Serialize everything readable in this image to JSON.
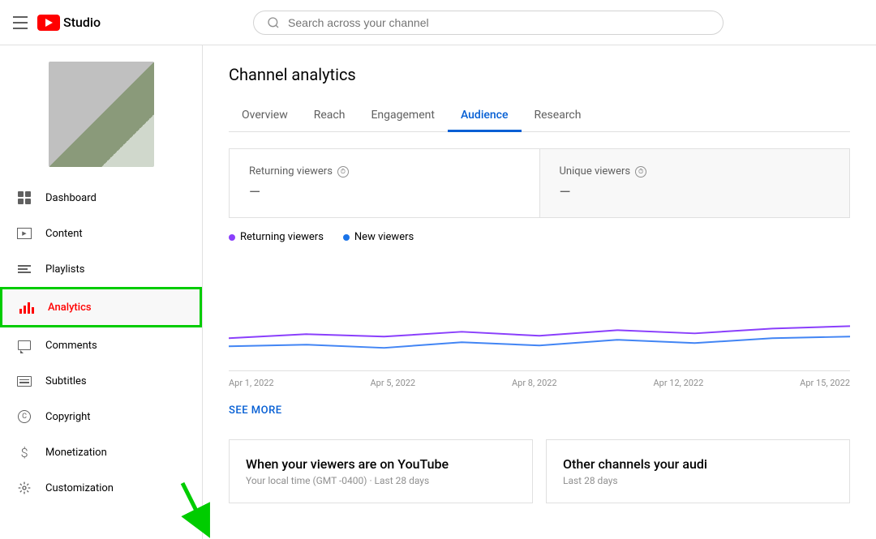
{
  "header": {
    "menu_icon": "hamburger-icon",
    "logo_text": "Studio",
    "search_placeholder": "Search across your channel"
  },
  "sidebar": {
    "nav_items": [
      {
        "id": "dashboard",
        "label": "Dashboard",
        "icon": "dashboard-icon",
        "active": false
      },
      {
        "id": "content",
        "label": "Content",
        "icon": "content-icon",
        "active": false
      },
      {
        "id": "playlists",
        "label": "Playlists",
        "icon": "playlists-icon",
        "active": false
      },
      {
        "id": "analytics",
        "label": "Analytics",
        "icon": "analytics-icon",
        "active": true
      },
      {
        "id": "comments",
        "label": "Comments",
        "icon": "comments-icon",
        "active": false
      },
      {
        "id": "subtitles",
        "label": "Subtitles",
        "icon": "subtitles-icon",
        "active": false
      },
      {
        "id": "copyright",
        "label": "Copyright",
        "icon": "copyright-icon",
        "active": false
      },
      {
        "id": "monetization",
        "label": "Monetization",
        "icon": "monetization-icon",
        "active": false
      },
      {
        "id": "customization",
        "label": "Customization",
        "icon": "customization-icon",
        "active": false
      }
    ]
  },
  "main": {
    "page_title": "Channel analytics",
    "tabs": [
      {
        "id": "overview",
        "label": "Overview",
        "active": false
      },
      {
        "id": "reach",
        "label": "Reach",
        "active": false
      },
      {
        "id": "engagement",
        "label": "Engagement",
        "active": false
      },
      {
        "id": "audience",
        "label": "Audience",
        "active": true
      },
      {
        "id": "research",
        "label": "Research",
        "active": false
      }
    ],
    "metrics": [
      {
        "id": "returning-viewers",
        "title": "Returning viewers",
        "value": "—"
      },
      {
        "id": "unique-viewers",
        "title": "Unique viewers",
        "value": "—"
      }
    ],
    "legend": [
      {
        "id": "returning",
        "label": "Returning viewers",
        "color": "purple"
      },
      {
        "id": "new",
        "label": "New viewers",
        "color": "blue"
      }
    ],
    "x_axis_labels": [
      "Apr 1, 2022",
      "Apr 5, 2022",
      "Apr 8, 2022",
      "Apr 12, 2022",
      "Apr 15, 2022"
    ],
    "see_more": "SEE MORE",
    "bottom_cards": [
      {
        "id": "when-viewers",
        "title": "When your viewers are on YouTube",
        "subtitle": "Your local time (GMT -0400) · Last 28 days"
      },
      {
        "id": "other-channels",
        "title": "Other channels your audi",
        "subtitle": "Last 28 days"
      }
    ]
  }
}
